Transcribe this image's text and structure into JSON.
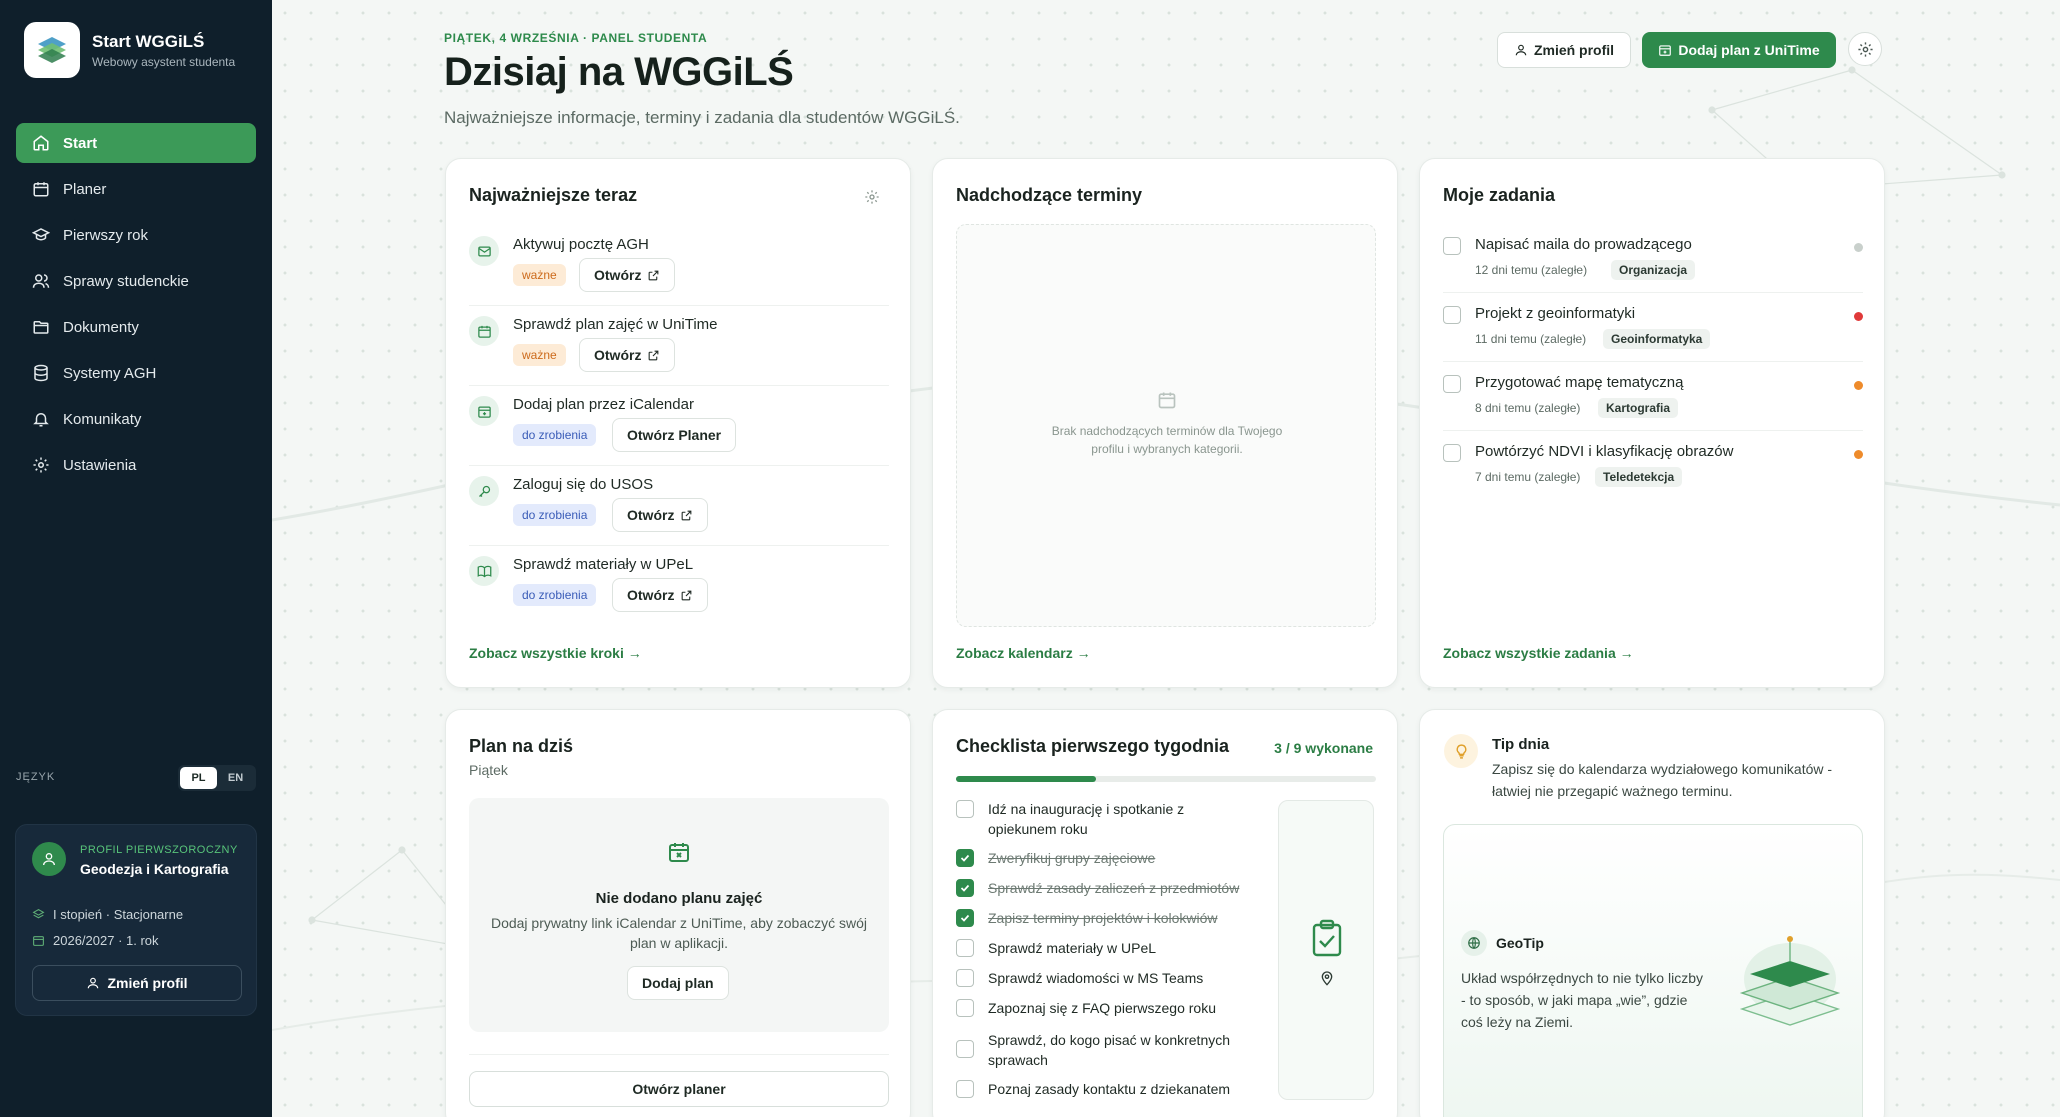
{
  "app": {
    "title": "Start WGGiLŚ",
    "subtitle": "Webowy asystent studenta"
  },
  "sidebar": {
    "items": [
      {
        "label": "Start",
        "icon": "home-icon",
        "active": true
      },
      {
        "label": "Planer",
        "icon": "calendar-icon"
      },
      {
        "label": "Pierwszy rok",
        "icon": "graduation-cap-icon"
      },
      {
        "label": "Sprawy studenckie",
        "icon": "users-icon"
      },
      {
        "label": "Dokumenty",
        "icon": "folder-icon"
      },
      {
        "label": "Systemy AGH",
        "icon": "database-icon"
      },
      {
        "label": "Komunikaty",
        "icon": "bell-icon"
      },
      {
        "label": "Ustawienia",
        "icon": "gear-icon"
      }
    ],
    "language": {
      "label": "JĘZYK",
      "options": [
        "PL",
        "EN"
      ],
      "selected": "PL"
    },
    "profile": {
      "label": "PROFIL PIERWSZOROCZNY",
      "name": "Geodezja i Kartografia",
      "level": "I stopień · Stacjonarne",
      "year": "2026/2027 · 1. rok",
      "button": "Zmień profil"
    }
  },
  "header": {
    "eyebrow": "PIĄTEK, 4 WRZEŚNIA · PANEL STUDENTA",
    "title": "Dzisiaj na WGGiLŚ",
    "subtitle": "Najważniejsze informacje, terminy i zadania dla studentów WGGiLŚ.",
    "change_profile": "Zmień profil",
    "add_plan": "Dodaj plan z UniTime"
  },
  "important": {
    "title": "Najważniejsze teraz",
    "steps": [
      {
        "title": "Aktywuj pocztę AGH",
        "badge": "ważne",
        "badge_type": "warn",
        "action": "Otwórz",
        "icon": "mail-icon"
      },
      {
        "title": "Sprawdź plan zajęć w UniTime",
        "badge": "ważne",
        "badge_type": "warn",
        "action": "Otwórz",
        "icon": "calendar-icon"
      },
      {
        "title": "Dodaj plan przez iCalendar",
        "badge": "do zrobienia",
        "badge_type": "todo",
        "action": "Otwórz Planer",
        "icon": "calendar-plus-icon"
      },
      {
        "title": "Zaloguj się do USOS",
        "badge": "do zrobienia",
        "badge_type": "todo",
        "action": "Otwórz",
        "icon": "key-icon"
      },
      {
        "title": "Sprawdź materiały w UPeL",
        "badge": "do zrobienia",
        "badge_type": "todo",
        "action": "Otwórz",
        "icon": "book-icon"
      }
    ],
    "link": "Zobacz wszystkie kroki"
  },
  "deadlines": {
    "title": "Nadchodzące terminy",
    "empty": "Brak nadchodzących terminów dla Twojego profilu i wybranych kategorii.",
    "link": "Zobacz kalendarz"
  },
  "tasks": {
    "title": "Moje zadania",
    "items": [
      {
        "title": "Napisać maila do prowadzącego",
        "meta": "12 dni temu (zaległe)",
        "tag": "Organizacja",
        "dot": "#c9d0cc"
      },
      {
        "title": "Projekt z geoinformatyki",
        "meta": "11 dni temu (zaległe)",
        "tag": "Geoinformatyka",
        "dot": "#e03a3a"
      },
      {
        "title": "Przygotować mapę tematyczną",
        "meta": "8 dni temu (zaległe)",
        "tag": "Kartografia",
        "dot": "#ee8b2b"
      },
      {
        "title": "Powtórzyć NDVI i klasyfikację obrazów",
        "meta": "7 dni temu (zaległe)",
        "tag": "Teledetekcja",
        "dot": "#ee8b2b"
      }
    ],
    "link": "Zobacz wszystkie zadania"
  },
  "plan": {
    "title": "Plan na dziś",
    "day": "Piątek",
    "empty_title": "Nie dodano planu zajęć",
    "empty_text": "Dodaj prywatny link iCalendar z UniTime, aby zobaczyć swój plan w aplikacji.",
    "add_button": "Dodaj plan",
    "open_button": "Otwórz planer"
  },
  "checklist": {
    "title": "Checklista pierwszego tygodnia",
    "progress_label": "3 / 9 wykonane",
    "progress": 0.333,
    "items": [
      {
        "label": "Idź na inaugurację i spotkanie z opiekunem roku",
        "done": false
      },
      {
        "label": "Zweryfikuj grupy zajęciowe",
        "done": true
      },
      {
        "label": "Sprawdź zasady zaliczeń z przedmiotów",
        "done": true
      },
      {
        "label": "Zapisz terminy projektów i kolokwiów",
        "done": true
      },
      {
        "label": "Sprawdź materiały w UPeL",
        "done": false
      },
      {
        "label": "Sprawdź wiadomości w MS Teams",
        "done": false
      },
      {
        "label": "Zapoznaj się z FAQ pierwszego roku",
        "done": false
      },
      {
        "label": "Sprawdź, do kogo pisać w konkretnych sprawach",
        "done": false
      },
      {
        "label": "Poznaj zasady kontaktu z dziekanatem",
        "done": false
      }
    ]
  },
  "tip": {
    "title": "Tip dnia",
    "text": "Zapisz się do kalendarza wydziałowego komunikatów - łatwiej nie przegapić ważnego terminu.",
    "geotip_title": "GeoTip",
    "geotip_text": "Układ współrzędnych to nie tylko liczby - to sposób, w jaki mapa „wie”, gdzie coś leży na Ziemi."
  },
  "colors": {
    "accent": "#2e8a4c",
    "sidebar": "#0f1f2b",
    "warn": "#cc6a1b",
    "todo": "#3a5cb8"
  }
}
